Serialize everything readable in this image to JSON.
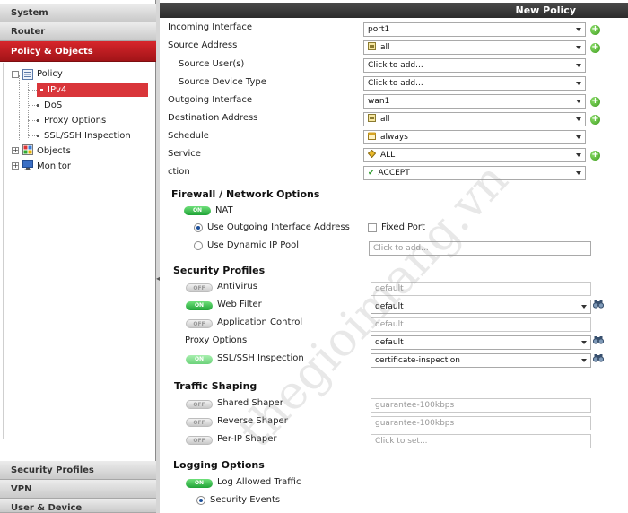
{
  "sidebar": {
    "top_nav": [
      "System",
      "Router",
      "Policy & Objects"
    ],
    "bottom_nav": [
      "Security Profiles",
      "VPN",
      "User & Device"
    ],
    "tree": {
      "policy": "Policy",
      "ipv4": "IPv4",
      "dos": "DoS",
      "proxy_options": "Proxy Options",
      "ssl_ssh": "SSL/SSH Inspection",
      "objects": "Objects",
      "monitor": "Monitor"
    }
  },
  "page_title": "New Policy",
  "form": {
    "incoming_interface": {
      "label": "Incoming Interface",
      "value": "port1"
    },
    "source_address": {
      "label": "Source Address",
      "value": "all"
    },
    "source_users": {
      "label": "Source User(s)",
      "value": "Click to add..."
    },
    "source_device_type": {
      "label": "Source Device Type",
      "value": "Click to add..."
    },
    "outgoing_interface": {
      "label": "Outgoing Interface",
      "value": "wan1"
    },
    "destination_address": {
      "label": "Destination Address",
      "value": "all"
    },
    "schedule": {
      "label": "Schedule",
      "value": "always"
    },
    "service": {
      "label": "Service",
      "value": "ALL"
    },
    "action": {
      "label": "ction",
      "value": "ACCEPT"
    }
  },
  "firewall": {
    "heading": "Firewall / Network Options",
    "nat_label": "NAT",
    "nat_toggle": "ON",
    "use_outgoing": "Use Outgoing Interface Address",
    "fixed_port": "Fixed Port",
    "use_dynamic_pool": "Use Dynamic IP Pool",
    "pool_placeholder": "Click to add..."
  },
  "security_profiles": {
    "heading": "Security Profiles",
    "rows": [
      {
        "label": "AntiVirus",
        "toggle": "OFF",
        "value": "default"
      },
      {
        "label": "Web Filter",
        "toggle": "ON",
        "value": "default"
      },
      {
        "label": "Application Control",
        "toggle": "OFF",
        "value": "default"
      },
      {
        "label": "Proxy Options",
        "toggle": "",
        "value": "default"
      },
      {
        "label": "SSL/SSH Inspection",
        "toggle": "ON",
        "value": "certificate-inspection"
      }
    ]
  },
  "traffic_shaping": {
    "heading": "Traffic Shaping",
    "rows": [
      {
        "label": "Shared Shaper",
        "toggle": "OFF",
        "value": "guarantee-100kbps"
      },
      {
        "label": "Reverse Shaper",
        "toggle": "OFF",
        "value": "guarantee-100kbps"
      },
      {
        "label": "Per-IP Shaper",
        "toggle": "OFF",
        "value": "Click to set..."
      }
    ]
  },
  "logging": {
    "heading": "Logging Options",
    "log_toggle": "ON",
    "log_allowed": "Log Allowed Traffic",
    "security_events": "Security Events"
  },
  "watermark": "thegioimang.vn",
  "colors": {
    "accent_red": "#c8191e",
    "toggle_green": "#2fb445",
    "title_bar": "#333333"
  }
}
